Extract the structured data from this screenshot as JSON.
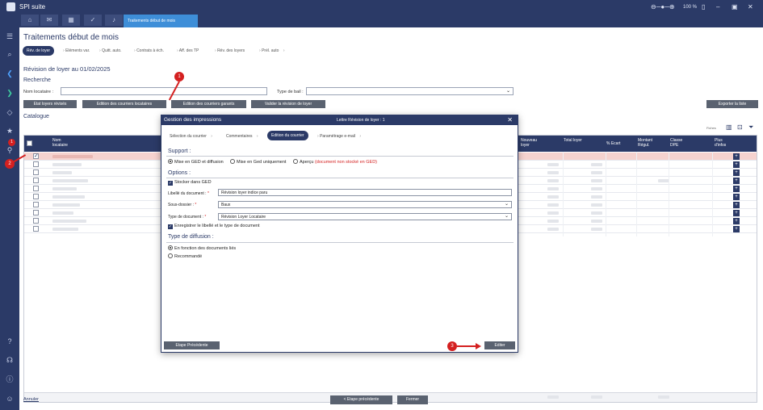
{
  "app": {
    "name": "SPI suite",
    "tab": "Traitements début de mois",
    "zoom": "100 %"
  },
  "page": {
    "title": "Traitements début de mois",
    "heading": "Révision de loyer au 01/02/2025"
  },
  "steps": [
    "Rév. de loyer",
    "Eléments var.",
    "Quitt. auto.",
    "Contrats à éch.",
    "Aff. des TP",
    "Rév. des loyers",
    "Prél. auto"
  ],
  "search": {
    "title": "Recherche",
    "nom_label": "Nom locataire :",
    "type_bail_label": "Type de bail :"
  },
  "buttons": {
    "etat": "Etat loyers révisés",
    "courriers_loc": "Edition des courriers locataires",
    "courriers_gar": "Edition des courriers garants",
    "valider": "Valider la révision de loyer",
    "exporter": "Exporter la liste",
    "etape_prec": "< Etape précédente",
    "fermer": "Fermer",
    "annuler": "Annuler"
  },
  "catalogue": {
    "title": "Catalogue",
    "count": "Fiches",
    "columns": {
      "nom": "Nom locataire",
      "nouveau": "Nouveau loyer",
      "total": "Total loyer",
      "ecart": "% Ecart",
      "montant": "Montant Régul.",
      "classe": "Classe DPE",
      "plus": "Plus d'infos"
    }
  },
  "modal": {
    "title": "Gestion des impressions",
    "subtitle": "Lettre Révision de loyer : 1",
    "steps": [
      "Sélection du courrier",
      "Commentaires",
      "Edition du courrier",
      "Paramétrage e-mail"
    ],
    "support_title": "Support :",
    "support_opts": [
      "Mise en GED et diffusion",
      "Mise en Ged uniquement",
      "Aperçu"
    ],
    "apercu_note": "(document non stocké en GED)",
    "options_title": "Options :",
    "stocker": "Stocker dans GED",
    "libelle_label": "Libellé du document :",
    "libelle_value": "Révision loyer indice paru",
    "sousdossier_label": "Sous-dossier :",
    "sousdossier_value": "Baux",
    "typedoc_label": "Type de document :",
    "typedoc_value": "Révision Loyer Locataire",
    "enregistrer": "Enregistrer le libellé et le type de document",
    "diffusion_title": "Type de diffusion :",
    "diffusion_opts": [
      "En fonction des documents liés",
      "Recommandé"
    ],
    "btn_prec": "Etape Précédente",
    "btn_editer": "Editer"
  },
  "annotations": [
    "1",
    "2",
    "3"
  ],
  "colors": {
    "navy": "#2b3a67",
    "accent": "#3e8ed8",
    "red": "#d42020"
  }
}
